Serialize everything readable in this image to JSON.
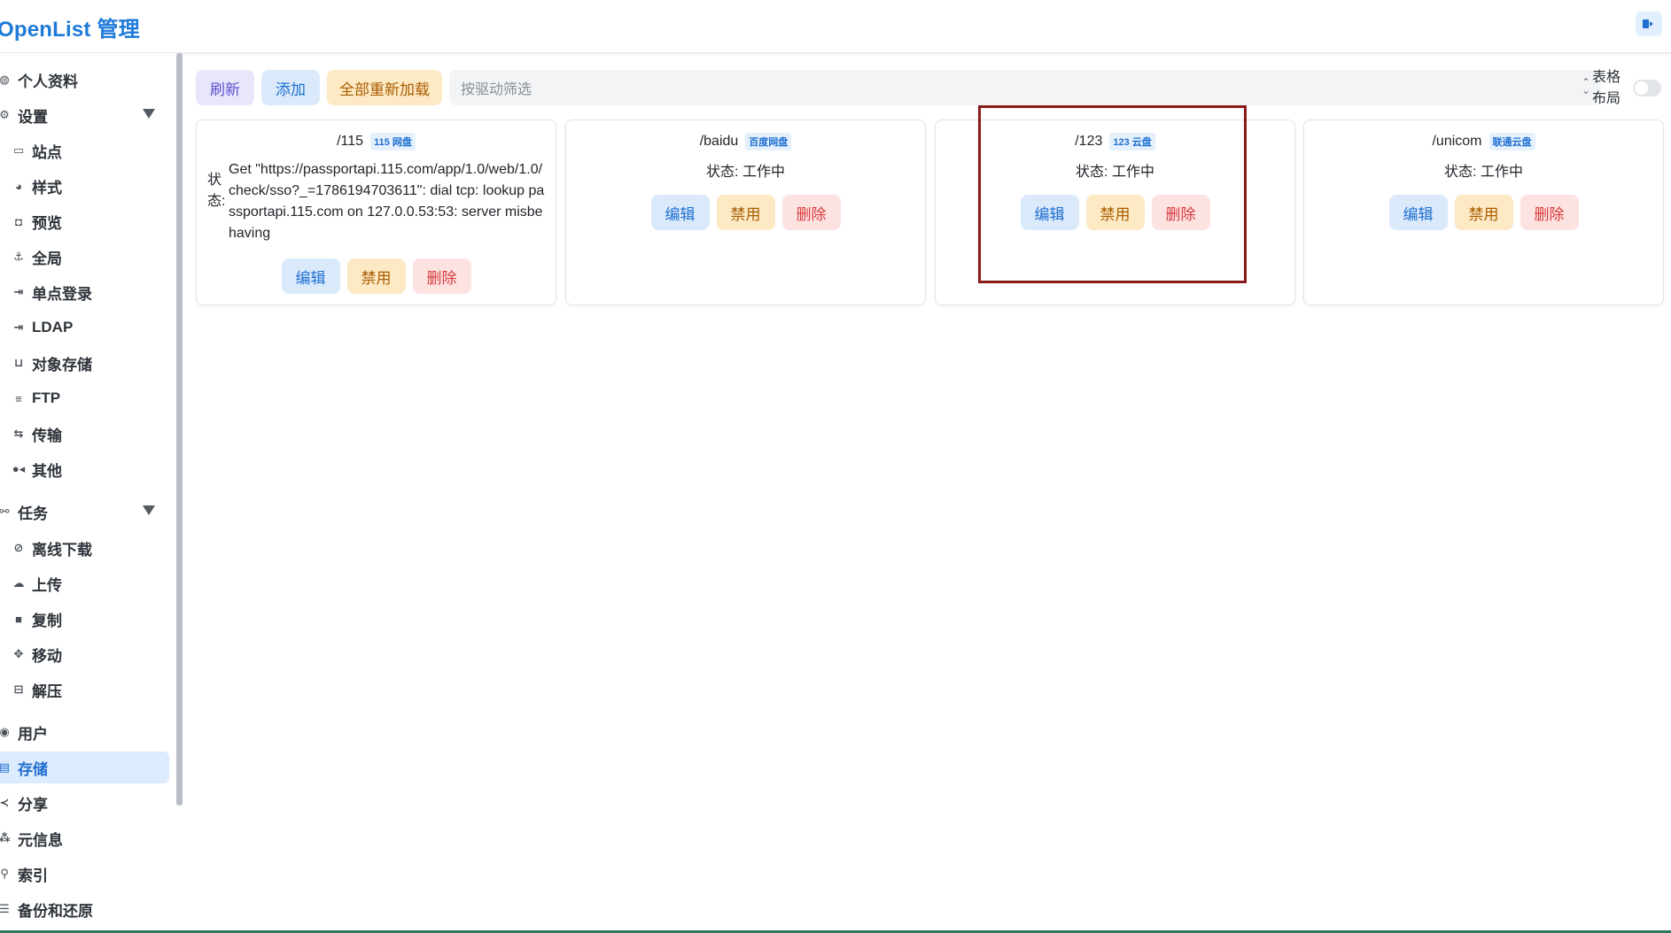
{
  "header": {
    "title": "OpenList 管理"
  },
  "sidebar": {
    "items": [
      {
        "label": "个人资料",
        "icon": "user-profile-icon",
        "level": "top"
      },
      {
        "label": "设置",
        "icon": "gear-icon",
        "level": "top",
        "expanded": true
      },
      {
        "label": "站点",
        "icon": "window-icon",
        "level": "sub"
      },
      {
        "label": "样式",
        "icon": "palette-icon",
        "level": "sub"
      },
      {
        "label": "预览",
        "icon": "camera-icon",
        "level": "sub"
      },
      {
        "label": "全局",
        "icon": "anchor-icon",
        "level": "sub"
      },
      {
        "label": "单点登录",
        "icon": "login-icon",
        "level": "sub"
      },
      {
        "label": "LDAP",
        "icon": "login-icon",
        "level": "sub"
      },
      {
        "label": "对象存储",
        "icon": "bucket-icon",
        "level": "sub"
      },
      {
        "label": "FTP",
        "icon": "ftp-icon",
        "level": "sub"
      },
      {
        "label": "传输",
        "icon": "transfer-icon",
        "level": "sub"
      },
      {
        "label": "其他",
        "icon": "dots-icon",
        "level": "sub"
      },
      {
        "label": "任务",
        "icon": "tasks-icon",
        "level": "top",
        "expanded": true
      },
      {
        "label": "离线下载",
        "icon": "offline-download-icon",
        "level": "sub"
      },
      {
        "label": "上传",
        "icon": "cloud-upload-icon",
        "level": "sub"
      },
      {
        "label": "复制",
        "icon": "copy-icon",
        "level": "sub"
      },
      {
        "label": "移动",
        "icon": "move-icon",
        "level": "sub"
      },
      {
        "label": "解压",
        "icon": "archive-icon",
        "level": "sub"
      },
      {
        "label": "用户",
        "icon": "user-icon",
        "level": "top"
      },
      {
        "label": "存储",
        "icon": "storage-icon",
        "level": "top",
        "active": true
      },
      {
        "label": "分享",
        "icon": "share-icon",
        "level": "top"
      },
      {
        "label": "元信息",
        "icon": "meta-icon",
        "level": "top"
      },
      {
        "label": "索引",
        "icon": "search-icon",
        "level": "top"
      },
      {
        "label": "备份和还原",
        "icon": "database-icon",
        "level": "top"
      }
    ]
  },
  "toolbar": {
    "refresh_label": "刷新",
    "add_label": "添加",
    "reload_all_label": "全部重新加载",
    "filter_placeholder": "按驱动筛选",
    "layout_toggle_label": "表格布局",
    "layout_toggle_on": false
  },
  "storages": [
    {
      "mount": "/115",
      "driver": "115 网盘",
      "status_label": "状态:",
      "status": "Get \"https://passportapi.115.com/app/1.0/web/1.0/check/sso?_=1786194703611\": dial tcp: lookup passportapi.115.com on 127.0.0.53:53: server misbehaving",
      "edit_label": "编辑",
      "disable_label": "禁用",
      "delete_label": "删除"
    },
    {
      "mount": "/baidu",
      "driver": "百度网盘",
      "status": "状态: 工作中",
      "edit_label": "编辑",
      "disable_label": "禁用",
      "delete_label": "删除"
    },
    {
      "mount": "/123",
      "driver": "123 云盘",
      "status": "状态: 工作中",
      "edit_label": "编辑",
      "disable_label": "禁用",
      "delete_label": "删除"
    },
    {
      "mount": "/unicom",
      "driver": "联通云盘",
      "status": "状态: 工作中",
      "edit_label": "编辑",
      "disable_label": "禁用",
      "delete_label": "删除"
    }
  ],
  "colors": {
    "accent": "#1e6fd0",
    "highlight_box": "#8b1a1a"
  }
}
